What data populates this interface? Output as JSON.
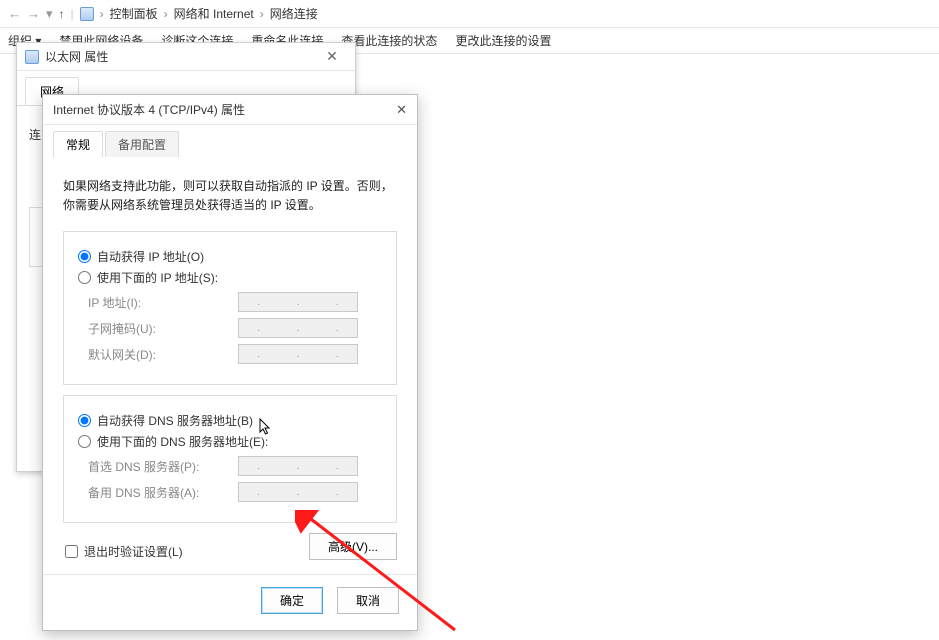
{
  "address_bar": {
    "path": [
      "控制面板",
      "网络和 Internet",
      "网络连接"
    ]
  },
  "toolbar": {
    "items": [
      "组织",
      "禁用此网络设备",
      "诊断这个连接",
      "重命名此连接",
      "查看此连接的状态",
      "更改此连接的设置"
    ]
  },
  "eth_window": {
    "title": "以太网 属性",
    "tab_network": "网络",
    "body_label": "连"
  },
  "ipv4": {
    "title": "Internet 协议版本 4 (TCP/IPv4) 属性",
    "tab_general": "常规",
    "tab_alt": "备用配置",
    "description": "如果网络支持此功能，则可以获取自动指派的 IP 设置。否则，你需要从网络系统管理员处获得适当的 IP 设置。",
    "radio_auto_ip": "自动获得 IP 地址(O)",
    "radio_manual_ip": "使用下面的 IP 地址(S):",
    "label_ip": "IP 地址(I):",
    "label_mask": "子网掩码(U):",
    "label_gateway": "默认网关(D):",
    "radio_auto_dns": "自动获得 DNS 服务器地址(B)",
    "radio_manual_dns": "使用下面的 DNS 服务器地址(E):",
    "label_dns1": "首选 DNS 服务器(P):",
    "label_dns2": "备用 DNS 服务器(A):",
    "chk_validate": "退出时验证设置(L)",
    "btn_advanced": "高级(V)...",
    "btn_ok": "确定",
    "btn_cancel": "取消"
  }
}
